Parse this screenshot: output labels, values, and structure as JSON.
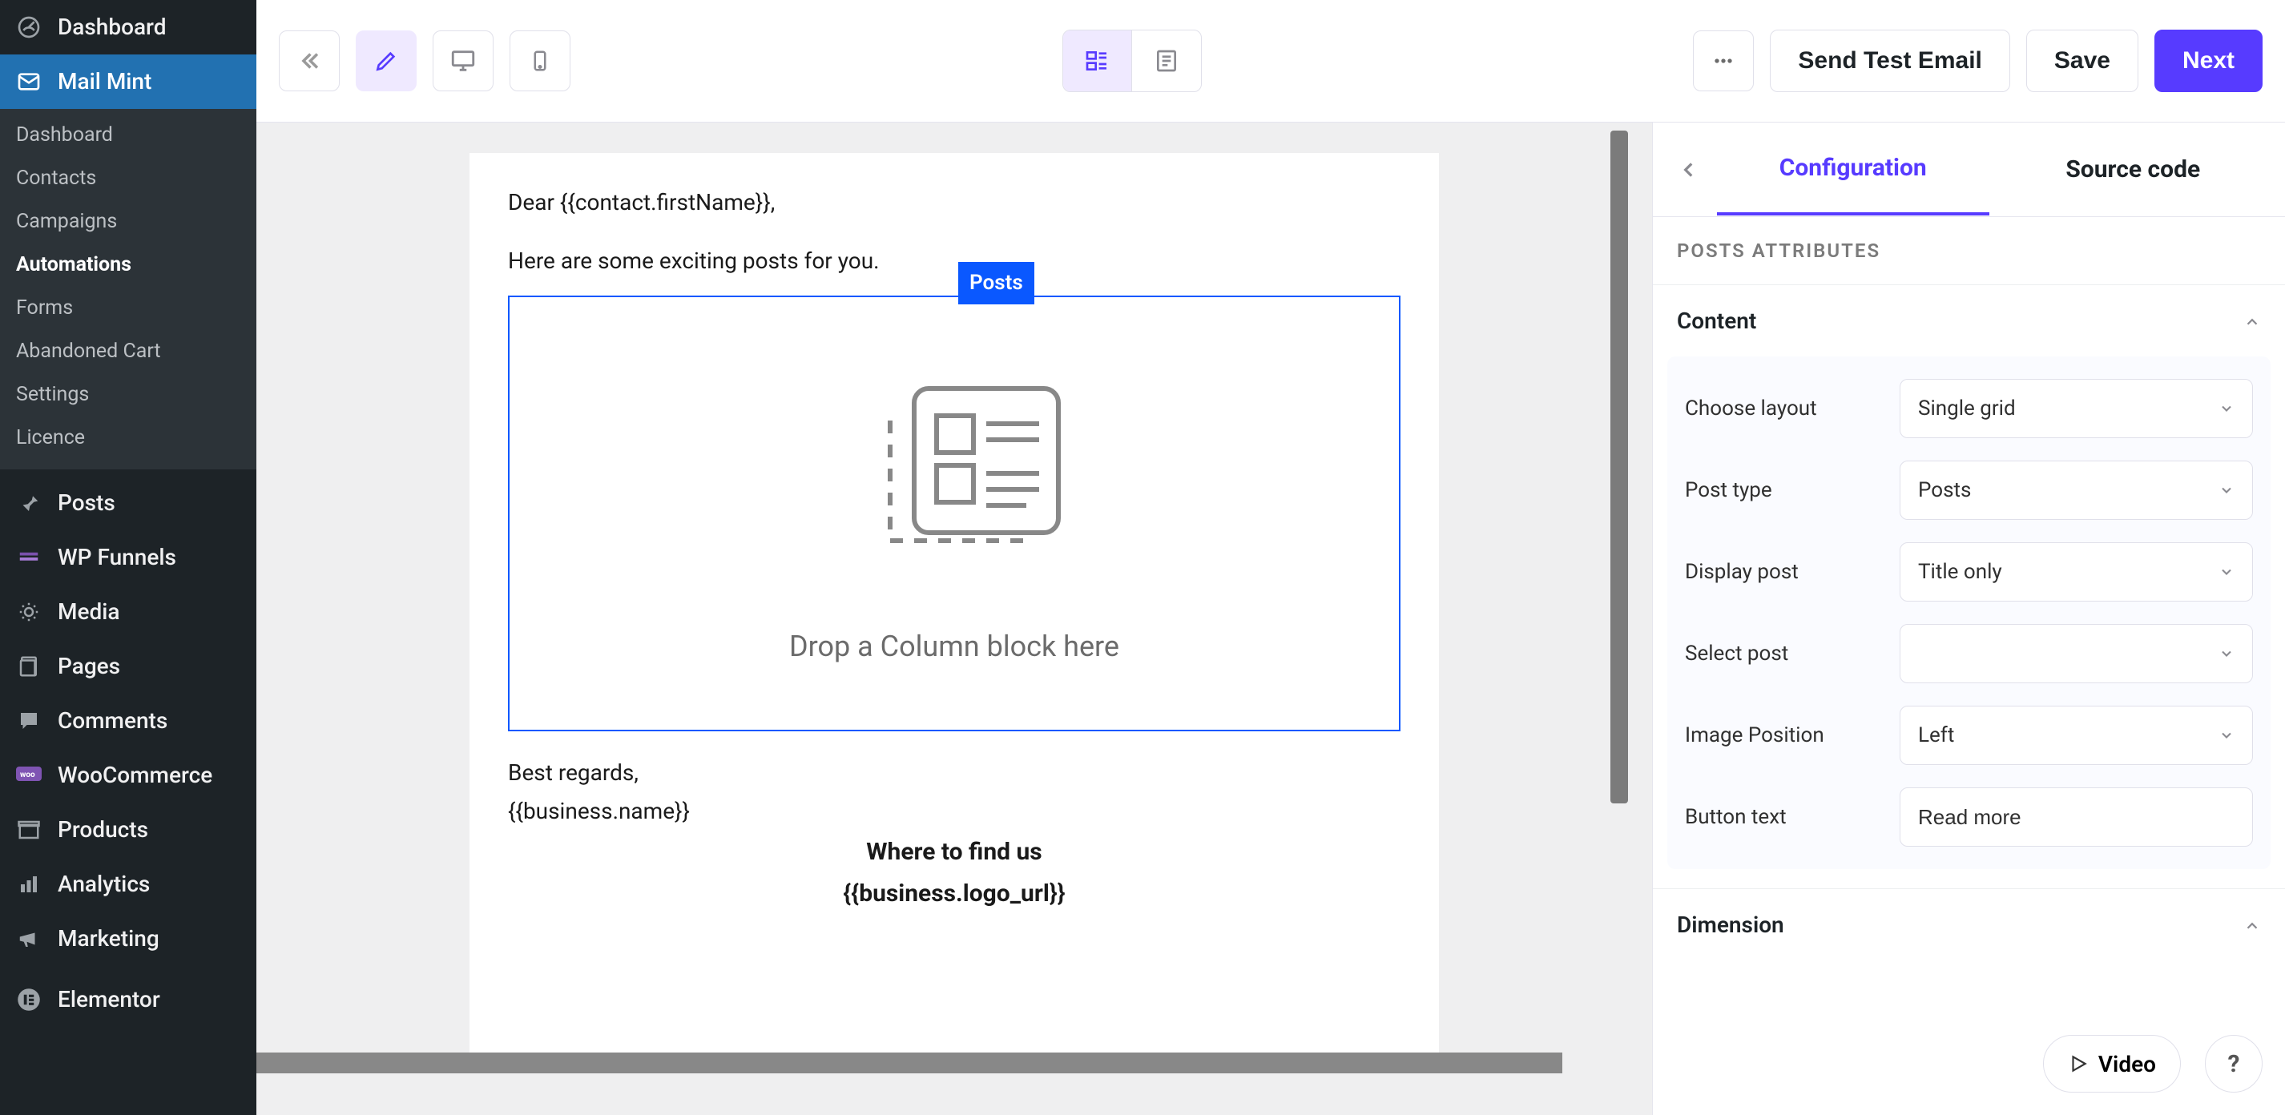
{
  "sidebar": {
    "main": [
      {
        "icon": "gauge-icon",
        "label": "Dashboard"
      },
      {
        "icon": "mail-icon",
        "label": "Mail Mint"
      }
    ],
    "sub": [
      {
        "label": "Dashboard"
      },
      {
        "label": "Contacts"
      },
      {
        "label": "Campaigns"
      },
      {
        "label": "Automations"
      },
      {
        "label": "Forms"
      },
      {
        "label": "Abandoned Cart"
      },
      {
        "label": "Settings"
      },
      {
        "label": "Licence"
      }
    ],
    "rest": [
      {
        "icon": "pin-icon",
        "label": "Posts"
      },
      {
        "icon": "funnel-icon",
        "label": "WP Funnels"
      },
      {
        "icon": "media-icon",
        "label": "Media"
      },
      {
        "icon": "page-icon",
        "label": "Pages"
      },
      {
        "icon": "comment-icon",
        "label": "Comments"
      },
      {
        "icon": "woo-icon",
        "label": "WooCommerce"
      },
      {
        "icon": "archive-icon",
        "label": "Products"
      },
      {
        "icon": "analytics-icon",
        "label": "Analytics"
      },
      {
        "icon": "megaphone-icon",
        "label": "Marketing"
      },
      {
        "icon": "elementor-icon",
        "label": "Elementor"
      }
    ]
  },
  "toolbar": {
    "send_test": "Send Test Email",
    "save": "Save",
    "next": "Next"
  },
  "canvas": {
    "line1": "Dear {{contact.firstName}},",
    "line2": "Here are some exciting posts for you.",
    "block_tag": "Posts",
    "drop_text": "Drop a Column block here",
    "closing1": "Best regards,",
    "closing2": "{{business.name}}",
    "footer_head": "Where to find us",
    "footer_logo": "{{business.logo_url}}"
  },
  "inspector": {
    "tabs": {
      "config": "Configuration",
      "source": "Source code"
    },
    "subheading": "POSTS ATTRIBUTES",
    "section_content": "Content",
    "section_dimension": "Dimension",
    "fields": {
      "choose_layout": {
        "label": "Choose layout",
        "value": "Single grid"
      },
      "post_type": {
        "label": "Post type",
        "value": "Posts"
      },
      "display_post": {
        "label": "Display post",
        "value": "Title only"
      },
      "select_post": {
        "label": "Select post",
        "value": ""
      },
      "image_position": {
        "label": "Image Position",
        "value": "Left"
      },
      "button_text": {
        "label": "Button text",
        "value": "Read more"
      }
    },
    "video_btn": "Video",
    "help_btn": "?"
  }
}
